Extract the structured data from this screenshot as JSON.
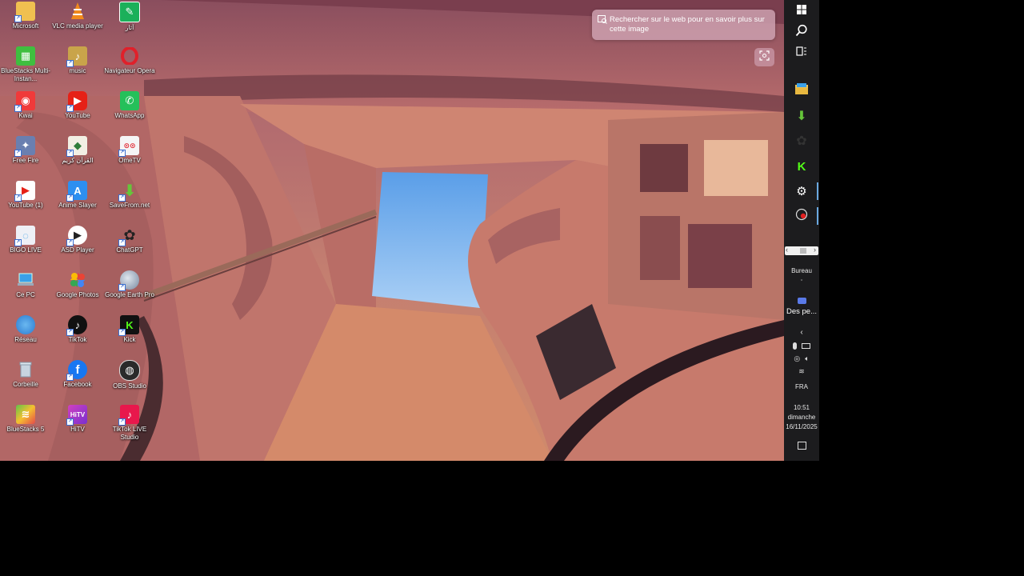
{
  "desktop": {
    "icons": [
      {
        "label": "Microsoft",
        "color": "#f0c050"
      },
      {
        "label": "VLC media player",
        "color": "#f08a1c"
      },
      {
        "label": "آثار",
        "color": "#1bb05a"
      },
      {
        "label": "BlueStacks Multi-Instan...",
        "color": "#3fbf3f"
      },
      {
        "label": "music",
        "color": "#c9a44a"
      },
      {
        "label": "Navigateur Opera",
        "color": "#e0202a"
      },
      {
        "label": "Kwai",
        "color": "#f03a3a"
      },
      {
        "label": "YouTube",
        "color": "#e62117"
      },
      {
        "label": "WhatsApp",
        "color": "#25c05a"
      },
      {
        "label": "Free Fire",
        "color": "#6a7fb0"
      },
      {
        "label": "القرآن كريم",
        "color": "#2f7d3a"
      },
      {
        "label": "OmeTV",
        "color": "#f5f5f5"
      },
      {
        "label": "YouTube (1)",
        "color": "#e62117"
      },
      {
        "label": "Anime Slayer",
        "color": "#2d8ff0"
      },
      {
        "label": "SaveFrom.net",
        "color": "#66c53a"
      },
      {
        "label": "BIGO LIVE",
        "color": "#eef0f6"
      },
      {
        "label": "ASD Player",
        "color": "#ffffff"
      },
      {
        "label": "ChatGPT",
        "color": "#222222"
      },
      {
        "label": "Ce PC",
        "color": "#3aa0e8"
      },
      {
        "label": "Google Photos",
        "color": "#f0b400"
      },
      {
        "label": "Google Earth Pro",
        "color": "#8899aa"
      },
      {
        "label": "Réseau",
        "color": "#3a8fe0"
      },
      {
        "label": "TikTok",
        "color": "#111111"
      },
      {
        "label": "Kick",
        "color": "#53fc18"
      },
      {
        "label": "Corbeille",
        "color": "#c8d4e0"
      },
      {
        "label": "Facebook",
        "color": "#1877f2"
      },
      {
        "label": "OBS Studio",
        "color": "#2a2a2a"
      },
      {
        "label": "BlueStacks 5",
        "color": "#5fc34a"
      },
      {
        "label": "HiTV",
        "color": "#d040c0"
      },
      {
        "label": "TikTok LIVE Studio",
        "color": "#e8184c"
      }
    ]
  },
  "visual_search": {
    "tip_text": "Rechercher sur le web pour en savoir plus sur cette image"
  },
  "taskbar": {
    "desktop_label": "Bureau",
    "widget_label": "Des pe...",
    "language": "FRA",
    "time": "10:51",
    "day": "dimanche",
    "date": "16/11/2025"
  }
}
